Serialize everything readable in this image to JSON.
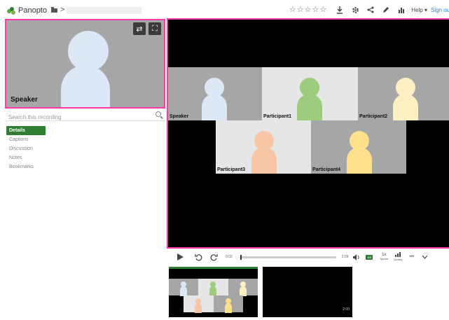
{
  "header": {
    "brand": "Panopto",
    "breadcrumb_sep": ">",
    "rating_stars": [
      "☆",
      "☆",
      "☆",
      "☆",
      "☆"
    ],
    "icons": [
      "download-icon",
      "settings-icon",
      "share-icon",
      "edit-icon",
      "stats-icon"
    ],
    "help_label": "Help ▾",
    "signout_label": "Sign out"
  },
  "speaker_video": {
    "label": "Speaker",
    "swap_icon": "⇄",
    "fullscreen_icon": "⛶"
  },
  "search": {
    "placeholder": "Search this recording"
  },
  "tabs": [
    "Details",
    "Captions",
    "Discussion",
    "Notes",
    "Bookmarks"
  ],
  "participants": [
    {
      "name": "Speaker",
      "color": "#dce8f5",
      "bg": "#a6a6a6"
    },
    {
      "name": "Participant1",
      "color": "#9ccc7c",
      "bg": "#e6e6e6"
    },
    {
      "name": "Participant2",
      "color": "#fff0c4",
      "bg": "#a6a6a6"
    },
    {
      "name": "Participant3",
      "color": "#f6c6a6",
      "bg": "#e6e6e6"
    },
    {
      "name": "Participant4",
      "color": "#ffe08a",
      "bg": "#a6a6a6"
    }
  ],
  "controls": {
    "current_time": "0:02",
    "duration": "2:09",
    "progress": 0.01,
    "cc_label": "CC",
    "speed_value": "1x",
    "speed_label": "Speed",
    "quality_label": "Quality",
    "more_label": "•••"
  },
  "thumbnails": [
    {
      "time": ""
    },
    {
      "time": "2:00"
    }
  ],
  "colors": {
    "accent_green": "#2e7d32",
    "highlight_pink": "#ff3ab0",
    "link_blue": "#1e88e5"
  }
}
